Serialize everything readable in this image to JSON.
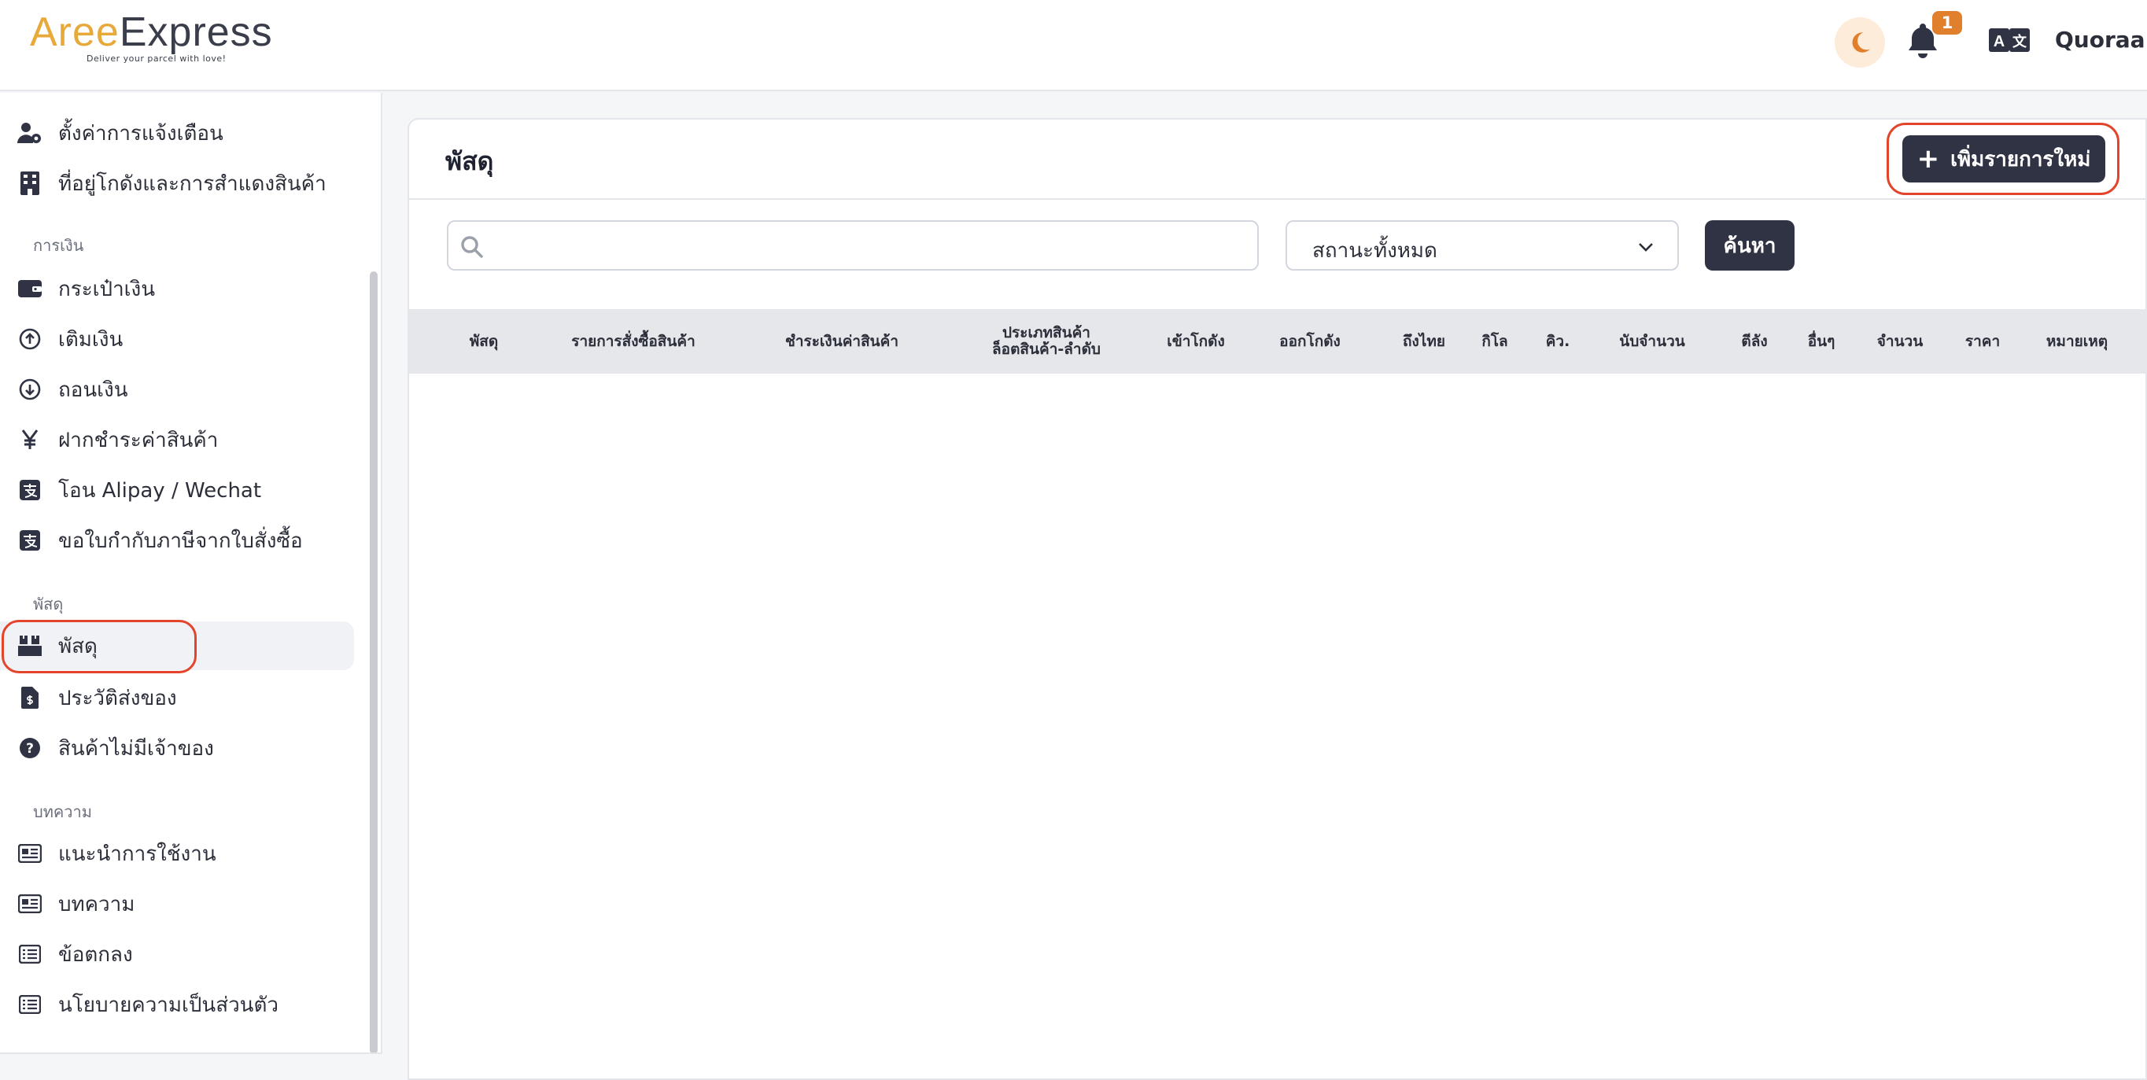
{
  "header": {
    "logo_brand_a": "Aree",
    "logo_brand_b": "Express",
    "logo_tagline": "Deliver your parcel with love!",
    "notification_count": "1",
    "user_name": "Quoraa"
  },
  "sidebar": {
    "items_top": [
      {
        "label": "ตั้งค่าการแจ้งเตือน",
        "icon": "user-gear-icon"
      },
      {
        "label": "ที่อยู่โกดังและการสำแดงสินค้า",
        "icon": "building-icon"
      }
    ],
    "section_finance": "การเงิน",
    "items_finance": [
      {
        "label": "กระเป๋าเงิน",
        "icon": "wallet-icon"
      },
      {
        "label": "เติมเงิน",
        "icon": "circle-arrow-up-icon"
      },
      {
        "label": "ถอนเงิน",
        "icon": "circle-arrow-down-icon"
      },
      {
        "label": "ฝากชำระค่าสินค้า",
        "icon": "yen-icon"
      },
      {
        "label": "โอน Alipay / Wechat",
        "icon": "alipay-icon"
      },
      {
        "label": "ขอใบกำกับภาษีจากใบสั่งซื้อ",
        "icon": "alipay-icon"
      }
    ],
    "section_parcel": "พัสดุ",
    "items_parcel": [
      {
        "label": "พัสดุ",
        "icon": "boxes-icon"
      },
      {
        "label": "ประวัติส่งของ",
        "icon": "file-invoice-icon"
      },
      {
        "label": "สินค้าไม่มีเจ้าของ",
        "icon": "question-circle-icon"
      }
    ],
    "section_articles": "บทความ",
    "items_articles": [
      {
        "label": "แนะนำการใช้งาน",
        "icon": "newspaper-icon"
      },
      {
        "label": "บทความ",
        "icon": "newspaper-icon"
      },
      {
        "label": "ข้อตกลง",
        "icon": "list-icon"
      },
      {
        "label": "นโยบายความเป็นส่วนตัว",
        "icon": "list-icon"
      }
    ]
  },
  "main": {
    "title": "พัสดุ",
    "add_button": "เพิ่มรายการใหม่",
    "search_placeholder": "",
    "status_selected": "สถานะทั้งหมด",
    "search_button": "ค้นหา",
    "columns": [
      "พัสดุ",
      "รายการสั่งซื้อสินค้า",
      "ชำระเงินค่าสินค้า",
      "ประเภทสินค้า\nล็อตสินค้า-ลำดับ",
      "เข้าโกดัง",
      "ออกโกดัง",
      "ถึงไทย",
      "กิโล",
      "คิว.",
      "นับจำนวน",
      "ตีลัง",
      "อื่นๆ",
      "จำนวน",
      "ราคา",
      "หมายเหตุ"
    ]
  }
}
